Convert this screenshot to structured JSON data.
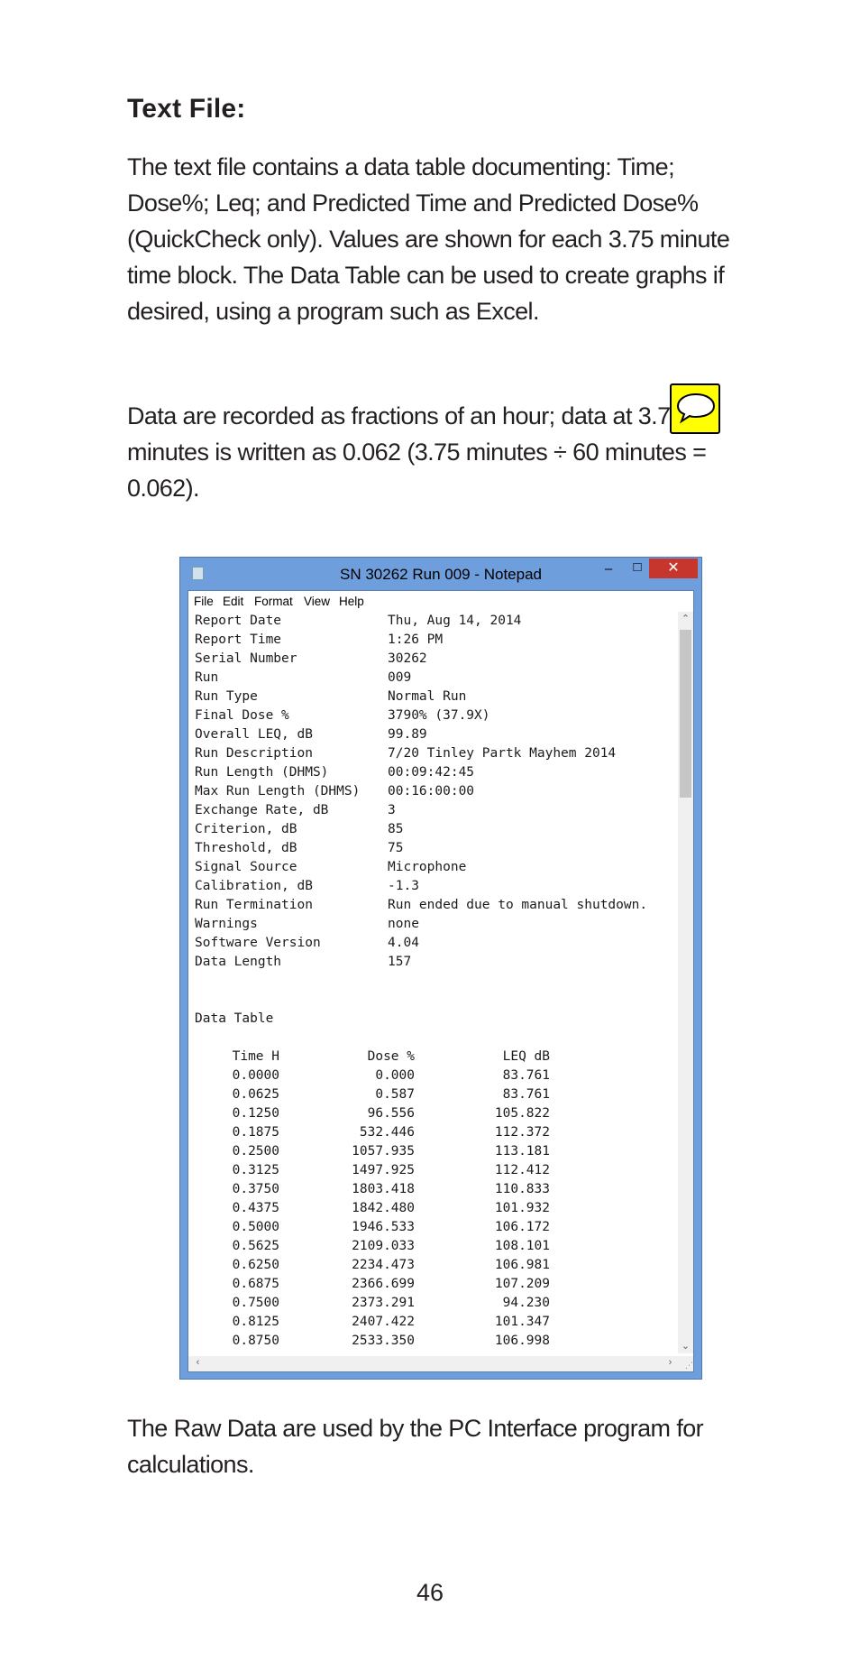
{
  "page": {
    "heading": "Text File:",
    "paragraph1": "The text file contains a data table documenting: Time; Dose%; Leq; and Predicted Time and Predicted Dose% (QuickCheck only). Values are shown for each 3.75 minute time block. The Data Table can be used to create graphs if desired, using a program such as Excel.",
    "paragraph2": "Data are recorded as fractions of an hour; data at 3.75 minutes is written as 0.062 (3.75 minutes ÷ 60 minutes = 0.062).",
    "paragraph3": "The Raw Data are used by the PC Interface program for calculations.",
    "page_number": "46",
    "comment_icon": "speech-bubble-icon"
  },
  "notepad": {
    "title": "SN 30262 Run 009 - Notepad",
    "controls": {
      "minimize": "–",
      "maximize": "□",
      "close": "✕"
    },
    "menu": [
      "File",
      "Edit",
      "Format",
      "View",
      "Help"
    ],
    "report": [
      {
        "key": "Report Date",
        "value": "Thu, Aug 14, 2014"
      },
      {
        "key": "Report Time",
        "value": "1:26 PM"
      },
      {
        "key": "Serial Number",
        "value": "30262"
      },
      {
        "key": "Run",
        "value": "009"
      },
      {
        "key": "Run Type",
        "value": "Normal Run"
      },
      {
        "key": "Final Dose %",
        "value": "3790% (37.9X)"
      },
      {
        "key": "Overall LEQ, dB",
        "value": "99.89"
      },
      {
        "key": "Run Description",
        "value": "7/20 Tinley Partk Mayhem 2014"
      },
      {
        "key": "Run Length (DHMS)",
        "value": "00:09:42:45"
      },
      {
        "key": "Max Run Length (DHMS)",
        "value": "00:16:00:00"
      },
      {
        "key": "Exchange Rate, dB",
        "value": "3"
      },
      {
        "key": "Criterion, dB",
        "value": "85"
      },
      {
        "key": "Threshold, dB",
        "value": "75"
      },
      {
        "key": "Signal Source",
        "value": "Microphone"
      },
      {
        "key": "Calibration, dB",
        "value": "-1.3"
      },
      {
        "key": "Run Termination",
        "value": "Run ended due to manual shutdown."
      },
      {
        "key": "Warnings",
        "value": "none"
      },
      {
        "key": "Software Version",
        "value": "4.04"
      },
      {
        "key": "Data Length",
        "value": "157"
      }
    ],
    "data_table_title": "Data Table",
    "columns": [
      "Time H",
      "Dose %",
      "LEQ dB"
    ],
    "rows": [
      [
        "0.0000",
        "0.000",
        "83.761"
      ],
      [
        "0.0625",
        "0.587",
        "83.761"
      ],
      [
        "0.1250",
        "96.556",
        "105.822"
      ],
      [
        "0.1875",
        "532.446",
        "112.372"
      ],
      [
        "0.2500",
        "1057.935",
        "113.181"
      ],
      [
        "0.3125",
        "1497.925",
        "112.412"
      ],
      [
        "0.3750",
        "1803.418",
        "110.833"
      ],
      [
        "0.4375",
        "1842.480",
        "101.932"
      ],
      [
        "0.5000",
        "1946.533",
        "106.172"
      ],
      [
        "0.5625",
        "2109.033",
        "108.101"
      ],
      [
        "0.6250",
        "2234.473",
        "106.981"
      ],
      [
        "0.6875",
        "2366.699",
        "107.209"
      ],
      [
        "0.7500",
        "2373.291",
        "94.230"
      ],
      [
        "0.8125",
        "2407.422",
        "101.347"
      ],
      [
        "0.8750",
        "2533.350",
        "106.998"
      ]
    ]
  }
}
